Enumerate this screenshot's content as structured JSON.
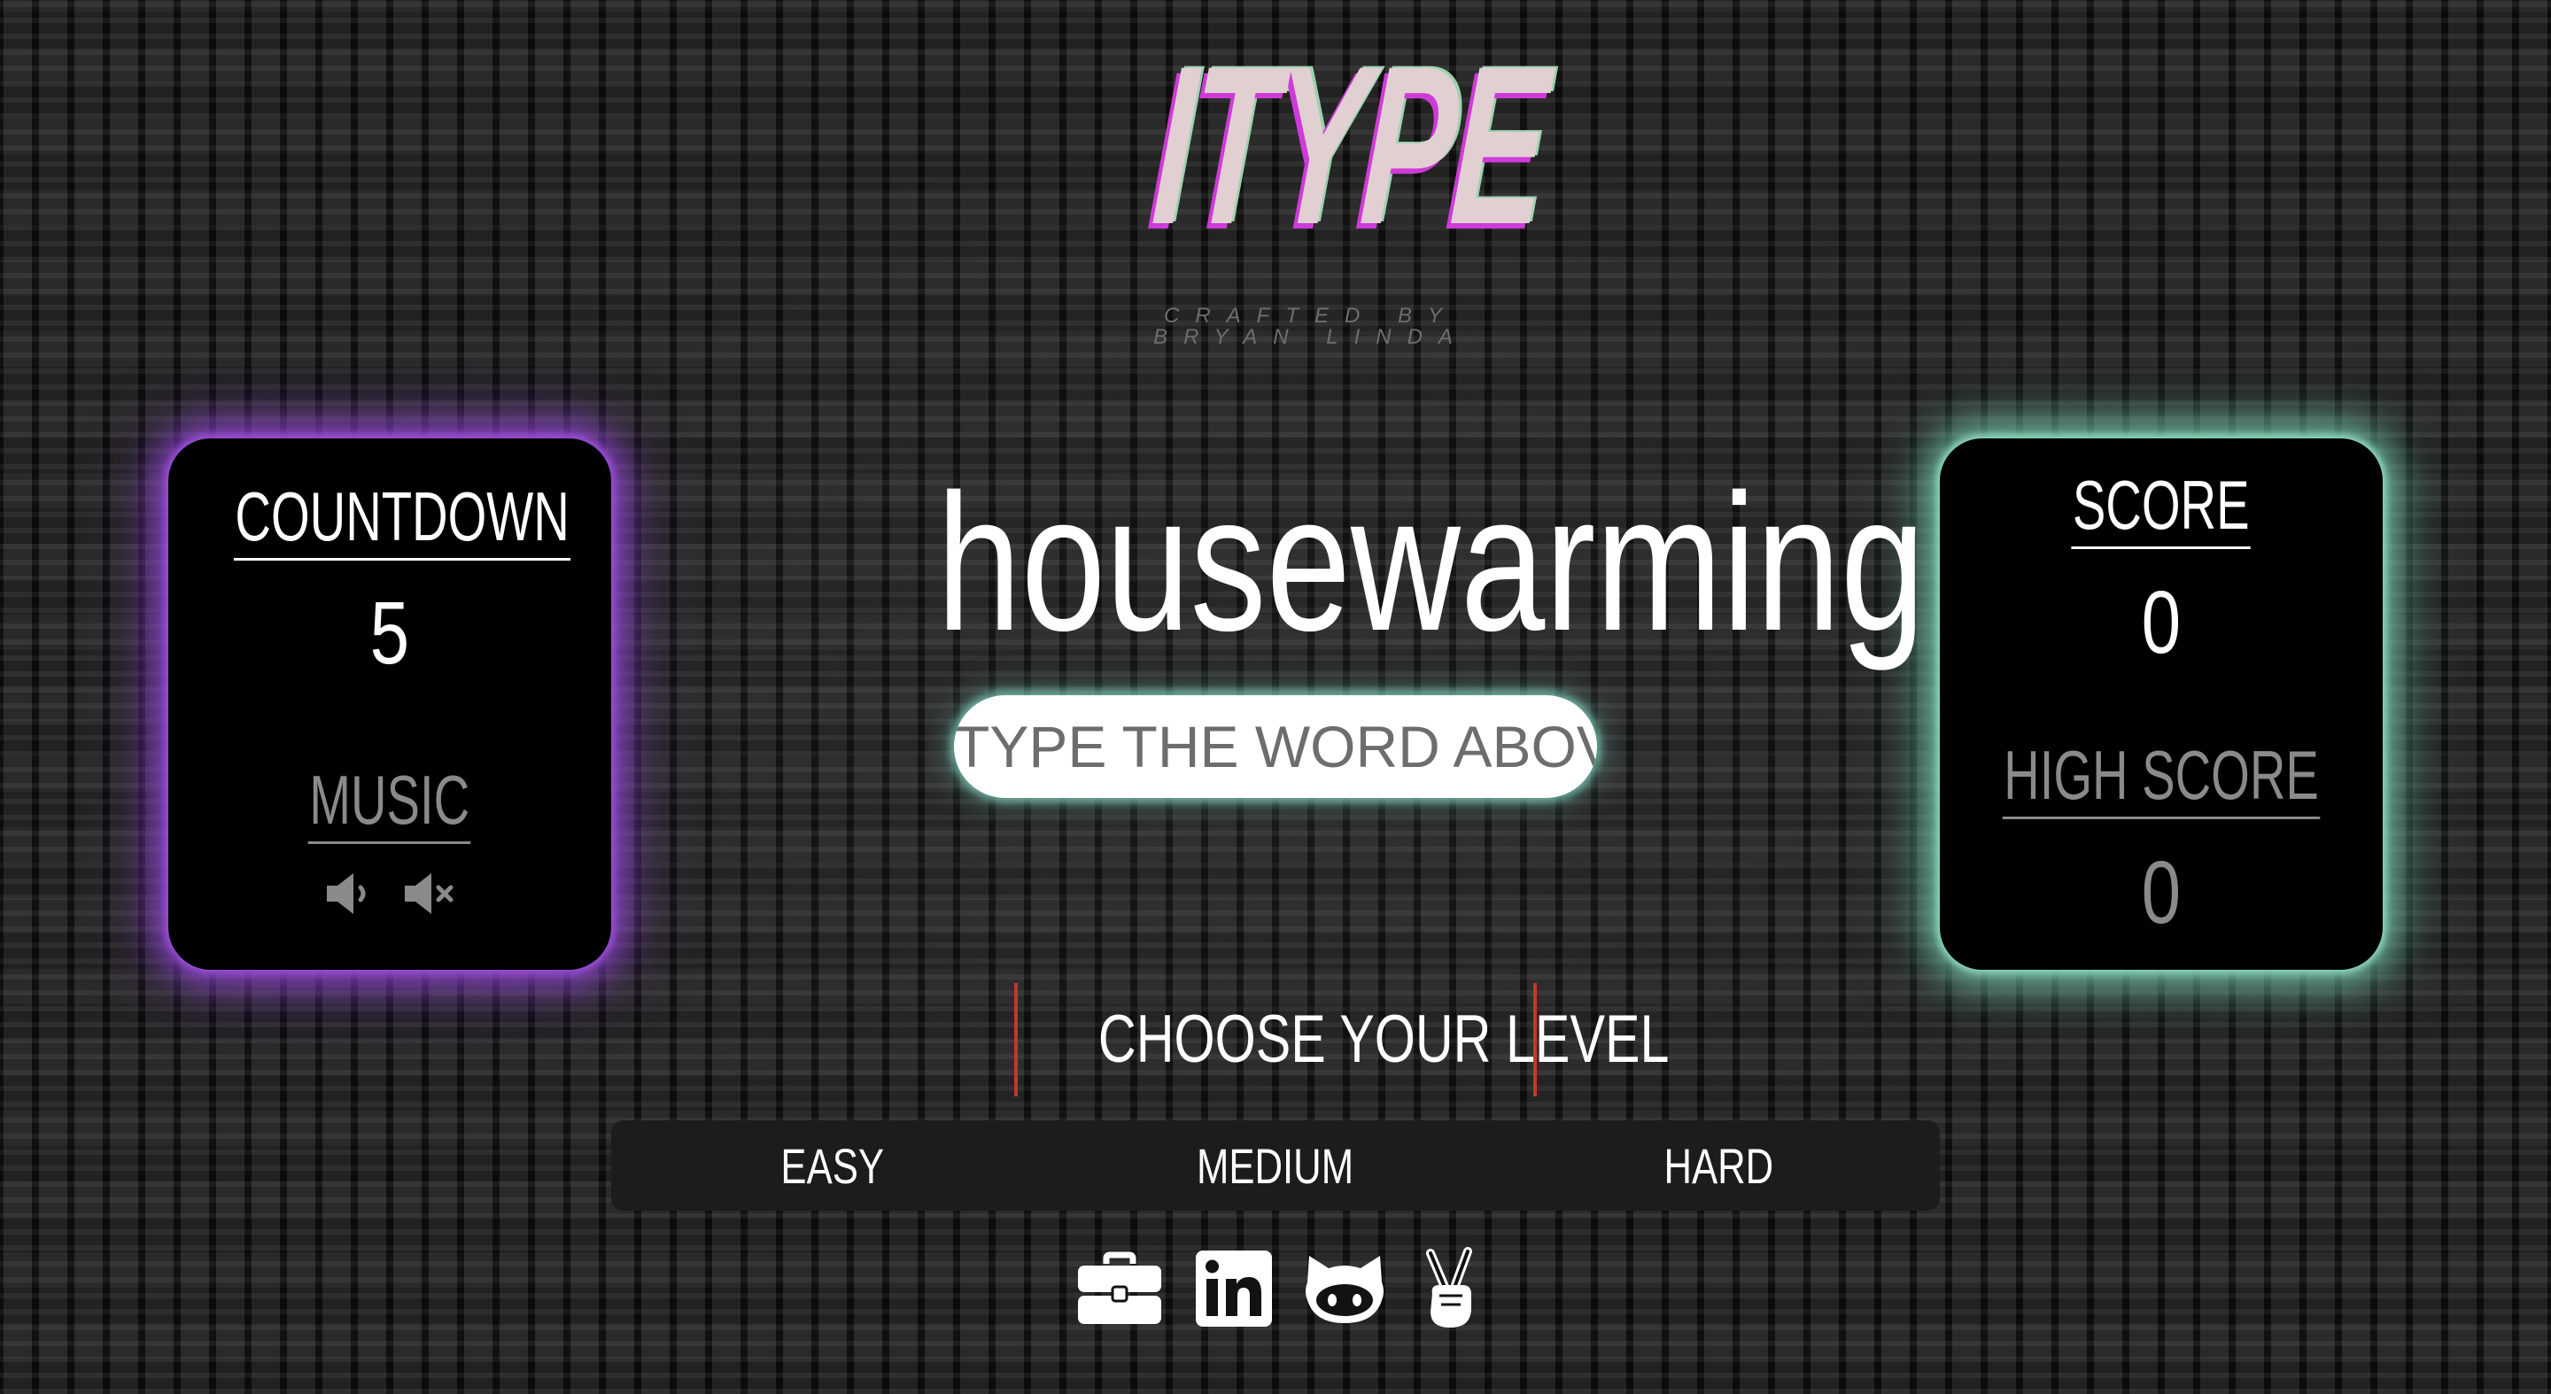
{
  "logo": {
    "title": "ITYPE"
  },
  "credit": {
    "line1": "CRAFTED BY",
    "line2": "BRYAN LINDA"
  },
  "countdown": {
    "label": "COUNTDOWN",
    "value": "5"
  },
  "music": {
    "label": "MUSIC",
    "icons": [
      "volume-on-icon",
      "volume-mute-icon"
    ]
  },
  "score": {
    "label": "SCORE",
    "value": "0"
  },
  "high_score": {
    "label": "HIGH SCORE",
    "value": "0"
  },
  "game": {
    "current_word": "housewarming",
    "input_placeholder": "TYPE THE WORD ABOVE",
    "input_value": ""
  },
  "levels": {
    "title": "CHOOSE YOUR LEVEL",
    "options": [
      {
        "label": "EASY"
      },
      {
        "label": "MEDIUM"
      },
      {
        "label": "HARD"
      }
    ]
  },
  "social": {
    "icons": [
      "briefcase-icon",
      "linkedin-icon",
      "github-icon",
      "peace-hand-icon"
    ]
  },
  "colors": {
    "countdown_glow": "#9a4fd6",
    "score_glow": "#8fd6bd",
    "logo_fill": "#e2cfd2",
    "logo_shadow": "#cf3bd8",
    "level_divider": "#c0392b"
  }
}
